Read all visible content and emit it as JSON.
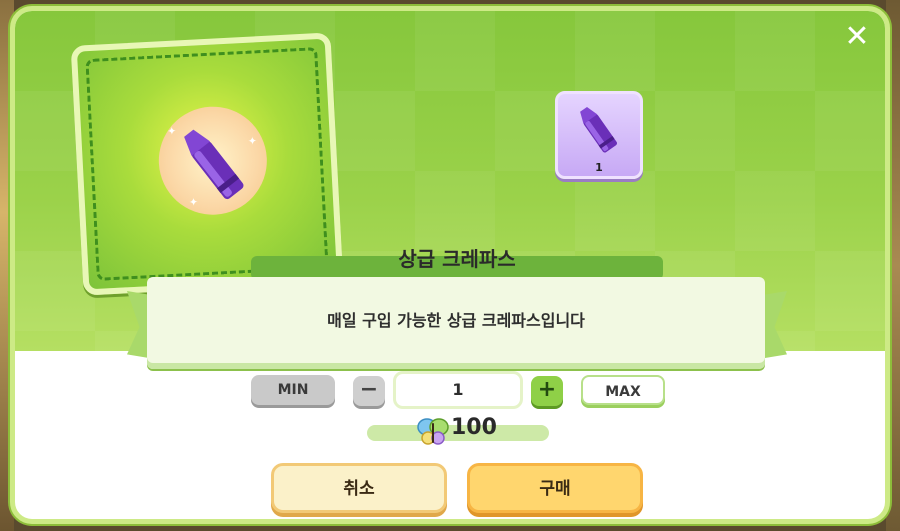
{
  "item": {
    "name": "상급 크레파스",
    "description": "매일 구입 가능한 상급 크레파스입니다",
    "icon": "purple-crayon-icon",
    "slot_count": "1"
  },
  "quantity": {
    "min_label": "MIN",
    "max_label": "MAX",
    "minus_symbol": "−",
    "plus_symbol": "+",
    "value": "1"
  },
  "price": {
    "currency_icon": "butterfly-icon",
    "amount": "100"
  },
  "buttons": {
    "cancel_label": "취소",
    "buy_label": "구매",
    "close_symbol": "✕"
  },
  "colors": {
    "panel_green": "#9bd24a",
    "title_bar": "#6db33c",
    "buy_button": "#ffd66e",
    "cancel_button": "#fbf1c9",
    "crayon_purple": "#7a3fc8"
  }
}
